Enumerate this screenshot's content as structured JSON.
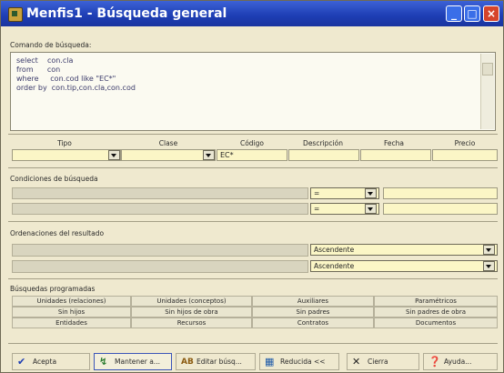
{
  "window": {
    "title": "Menfis1 - Búsqueda general"
  },
  "sql": {
    "label": "Comando de búsqueda:",
    "lines": [
      "select    con.cla",
      "from      con",
      "where     con.cod like \"EC*\"",
      "order by  con.tip,con.cla,con.cod"
    ]
  },
  "filters": {
    "headers": [
      "Tipo",
      "Clase",
      "Código",
      "Descripción",
      "Fecha",
      "Precio"
    ],
    "codigo_value": "EC*"
  },
  "conditions": {
    "label": "Condiciones de búsqueda",
    "rows": [
      {
        "operator": "="
      },
      {
        "operator": "="
      }
    ]
  },
  "ordering": {
    "label": "Ordenaciones del resultado",
    "rows": [
      {
        "value": "Ascendente"
      },
      {
        "value": "Ascendente"
      }
    ]
  },
  "programmed": {
    "label": "Búsquedas programadas",
    "buttons": [
      [
        "Unidades (relaciones)",
        "Unidades (conceptos)",
        "Auxiliares",
        "Paramétricos"
      ],
      [
        "Sin hijos",
        "Sin hijos de obra",
        "Sin padres",
        "Sin padres de obra"
      ],
      [
        "Entidades",
        "Recursos",
        "Contratos",
        "Documentos"
      ]
    ]
  },
  "toolbar": {
    "accept": "Acepta",
    "maintain": "Mantener a...",
    "edit": "Editar búsq...",
    "reduce": "Reducida <<",
    "close": "Cierra",
    "help": "Ayuda..."
  },
  "colors": {
    "titlebar": "#1d3db3",
    "field_bg": "#fbf6c6",
    "window_bg": "#efe9cf"
  }
}
